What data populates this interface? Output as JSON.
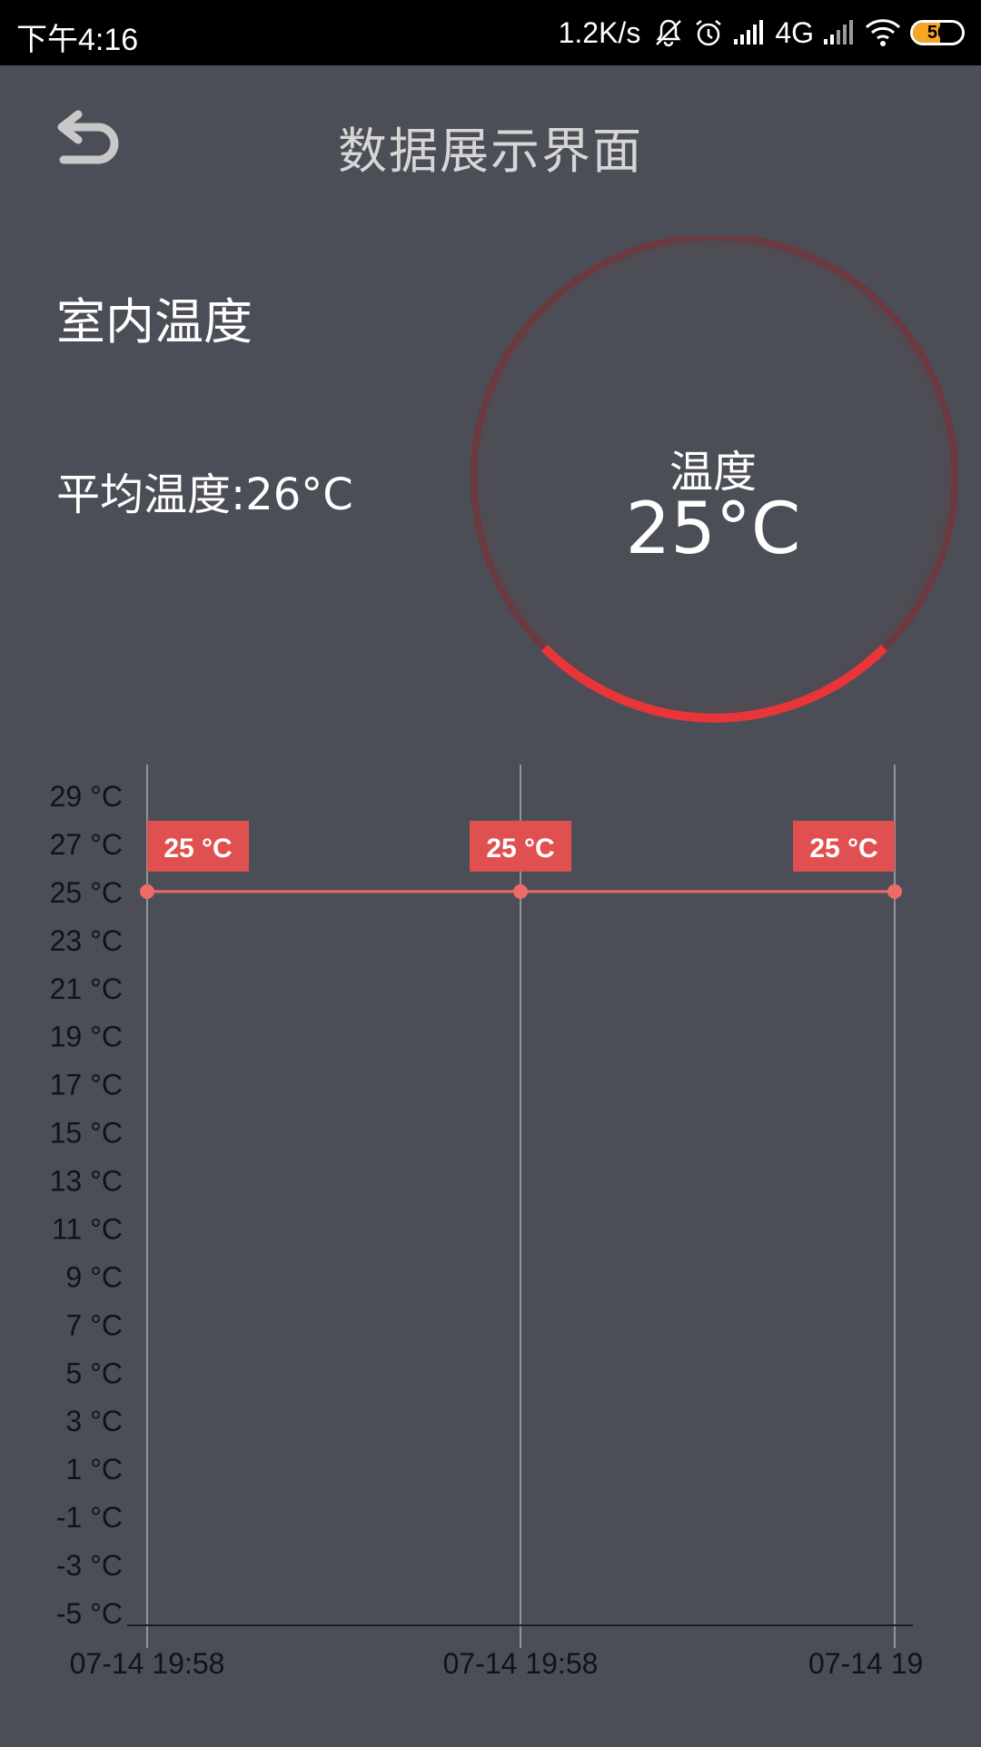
{
  "status_bar": {
    "time": "下午4:16",
    "speed": "1.2K/s",
    "network": "4G",
    "battery": "56",
    "battery_level": 0.56,
    "icons": [
      "mute-bell-icon",
      "alarm-icon",
      "signal-icon",
      "signal-icon",
      "wifi-icon",
      "battery-icon"
    ]
  },
  "header": {
    "title": "数据展示界面",
    "back_icon": "back-arrow-icon"
  },
  "info": {
    "room_label": "室内温度",
    "avg_label": "平均温度",
    "avg_separator": ":",
    "avg_value": "26°C"
  },
  "gauge": {
    "label": "温度",
    "value": "25°C",
    "colors": {
      "track": "#6a3a40",
      "active": "#e8353a"
    }
  },
  "chart_data": {
    "type": "line",
    "x": [
      "07-14 19:58",
      "07-14 19:58",
      "07-14 19"
    ],
    "series": [
      {
        "values": [
          25,
          25,
          25
        ],
        "labels": [
          "25 °C",
          "25 °C",
          "25 °C"
        ],
        "color": "#f06a6a"
      }
    ],
    "y_ticks": [
      "29 °C",
      "27 °C",
      "25 °C",
      "23 °C",
      "21 °C",
      "19 °C",
      "17 °C",
      "15 °C",
      "13 °C",
      "11 °C",
      "9 °C",
      "7 °C",
      "5 °C",
      "3 °C",
      "1 °C",
      "-1 °C",
      "-3 °C",
      "-5 °C"
    ],
    "y_tick_values": [
      29,
      27,
      25,
      23,
      21,
      19,
      17,
      15,
      13,
      11,
      9,
      7,
      5,
      3,
      1,
      -1,
      -3,
      -5
    ],
    "ylim": [
      -5,
      29
    ],
    "grid": "vertical",
    "title": "",
    "xlabel": "",
    "ylabel": ""
  }
}
